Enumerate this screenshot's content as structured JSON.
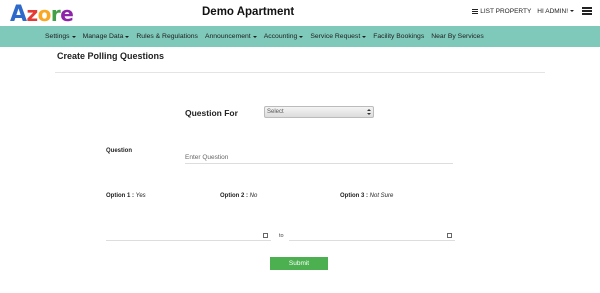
{
  "header": {
    "logo": {
      "a": "A",
      "z": "z",
      "o": "o",
      "r": "r",
      "e": "e"
    },
    "site_title": "Demo Apartment",
    "list_property": "LIST PROPERTY",
    "user_menu": "HI ADMIN!"
  },
  "nav": {
    "items": [
      {
        "label": "Settings"
      },
      {
        "label": "Manage Data"
      },
      {
        "label": "Rules & Regulations"
      },
      {
        "label": "Announcement"
      },
      {
        "label": "Accounting"
      },
      {
        "label": "Service Request"
      },
      {
        "label": "Facility Bookings"
      },
      {
        "label": "Near By Services"
      }
    ]
  },
  "form": {
    "page_title": "Create Polling Questions",
    "question_for_label": "Question For",
    "question_for_selected": "Select",
    "question_label": "Question",
    "question_placeholder": "Enter Question",
    "options": [
      {
        "label": "Option 1 :",
        "value": "Yes"
      },
      {
        "label": "Option 2 :",
        "value": "No"
      },
      {
        "label": "Option 3 :",
        "value": "Not Sure"
      }
    ],
    "to_label": "to",
    "submit_label": "Submit"
  },
  "colors": {
    "nav_bg": "#7fc9bb",
    "submit_bg": "#4caf50"
  }
}
